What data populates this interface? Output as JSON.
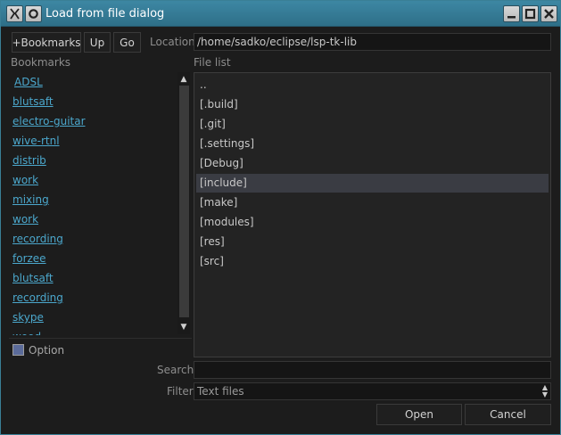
{
  "window": {
    "title": "Load from file dialog",
    "app_icon": "x-logo-icon",
    "menu_icon": "ring-menu-icon",
    "controls": [
      "minimize-icon",
      "maximize-icon",
      "close-icon"
    ]
  },
  "toolbar": {
    "bookmarks_label": "+Bookmarks",
    "up_label": "Up",
    "go_label": "Go",
    "location_label": "Location",
    "location_value": "/home/sadko/eclipse/lsp-tk-lib"
  },
  "bookmarks": {
    "heading": "Bookmarks",
    "items": [
      "ADSL",
      "blutsaft",
      "electro-guitar",
      "wive-rtnl",
      "distrib",
      "work",
      "mixing",
      "work",
      "recording",
      "forzee",
      "blutsaft",
      "recording",
      "skype",
      "wood"
    ]
  },
  "files": {
    "heading": "File list",
    "items": [
      "..",
      "[.build]",
      "[.git]",
      "[.settings]",
      "[Debug]",
      "[include]",
      "[make]",
      "[modules]",
      "[res]",
      "[src]"
    ],
    "selected": "[include]"
  },
  "option": {
    "label": "Option",
    "checked": false
  },
  "search": {
    "label": "Search",
    "value": ""
  },
  "filter": {
    "label": "Filter",
    "value": "Text files"
  },
  "actions": {
    "open_label": "Open",
    "cancel_label": "Cancel"
  },
  "colors": {
    "accent": "#3d87a3",
    "link": "#4ba7cc",
    "selection": "#3a3c43"
  }
}
